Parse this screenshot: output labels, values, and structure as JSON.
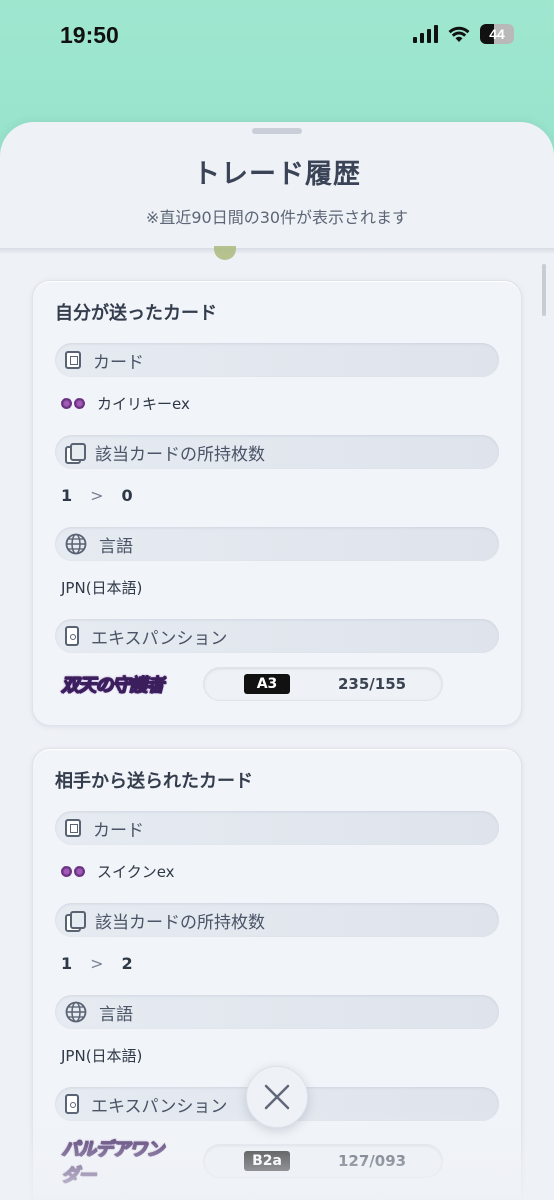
{
  "status_bar": {
    "time": "19:50",
    "battery": "44",
    "icons": [
      "signal-icon",
      "wifi-icon",
      "battery-icon"
    ]
  },
  "sheet": {
    "title": "トレード履歴",
    "subtitle": "※直近90日間の30件が表示されます"
  },
  "sent": {
    "title": "自分が送ったカード",
    "card_label": "カード",
    "card_name": "カイリキーex",
    "count_label": "該当カードの所持枚数",
    "count_from": "1",
    "count_sep": ">",
    "count_to": "0",
    "language_label": "言語",
    "language": "JPN(日本語)",
    "expansion_label": "エキスパンション",
    "expansion_logo": "双天の守護者",
    "expansion_code": "A3",
    "expansion_number": "235/155"
  },
  "received": {
    "title": "相手から送られたカード",
    "card_label": "カード",
    "card_name": "スイクンex",
    "count_label": "該当カードの所持枚数",
    "count_from": "1",
    "count_sep": ">",
    "count_to": "2",
    "language_label": "言語",
    "language": "JPN(日本語)",
    "expansion_label": "エキスパンション",
    "expansion_logo": "パルデアワンダー",
    "expansion_code": "B2a",
    "expansion_number": "127/093"
  },
  "close_icon": "close-icon"
}
